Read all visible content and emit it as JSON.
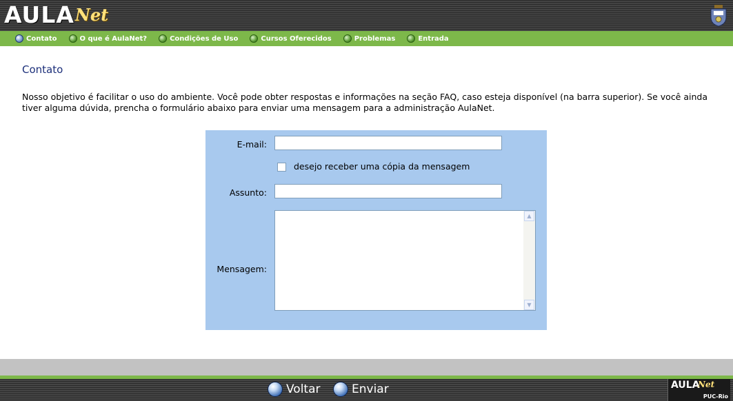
{
  "header": {
    "logo_main": "AULA",
    "logo_accent": "Net",
    "crest_icon": "university-crest-icon"
  },
  "menu": {
    "items": [
      {
        "label": "Contato",
        "active": true
      },
      {
        "label": "O que é AulaNet?",
        "active": false
      },
      {
        "label": "Condições de Uso",
        "active": false
      },
      {
        "label": "Cursos Oferecidos",
        "active": false
      },
      {
        "label": "Problemas",
        "active": false
      },
      {
        "label": "Entrada",
        "active": false
      }
    ]
  },
  "page": {
    "title": "Contato",
    "intro": "Nosso objetivo é facilitar o uso do ambiente. Você pode obter respostas e informações na seção FAQ, caso esteja disponível (na barra superior). Se você ainda tiver alguma dúvida, prencha o formulário abaixo para enviar uma mensagem para a administração AulaNet."
  },
  "form": {
    "email_label": "E-mail:",
    "email_value": "",
    "copy_checkbox_label": "desejo receber uma cópia da mensagem",
    "copy_checked": false,
    "subject_label": "Assunto:",
    "subject_value": "",
    "message_label": "Mensagem:",
    "message_value": ""
  },
  "footer": {
    "back_label": "Voltar",
    "send_label": "Enviar",
    "logo_main": "AULA",
    "logo_accent": "Net",
    "logo_sub": "PUC-Rio"
  },
  "colors": {
    "menu_green": "#7db84a",
    "form_blue": "#a8c9ee",
    "title_blue": "#1c2f7a"
  }
}
